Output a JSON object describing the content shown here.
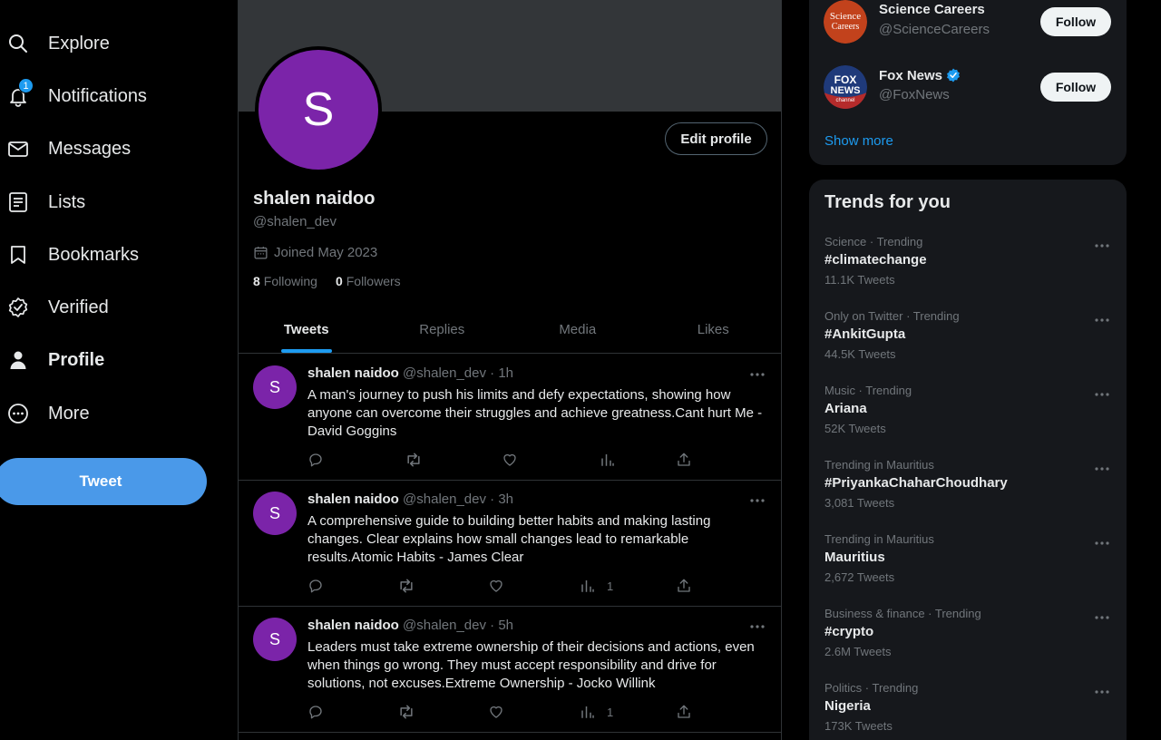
{
  "nav": {
    "items": [
      {
        "label": "Explore",
        "icon": "search-icon"
      },
      {
        "label": "Notifications",
        "icon": "bell-icon",
        "badge": "1"
      },
      {
        "label": "Messages",
        "icon": "envelope-icon"
      },
      {
        "label": "Lists",
        "icon": "list-icon"
      },
      {
        "label": "Bookmarks",
        "icon": "bookmark-icon"
      },
      {
        "label": "Verified",
        "icon": "verified-icon"
      },
      {
        "label": "Profile",
        "icon": "person-icon",
        "active": true
      },
      {
        "label": "More",
        "icon": "more-circle-icon"
      }
    ],
    "tweet_button": "Tweet"
  },
  "profile": {
    "avatar_letter": "S",
    "edit_button": "Edit profile",
    "name": "shalen naidoo",
    "handle": "@shalen_dev",
    "joined": "Joined May 2023",
    "following_count": "8",
    "following_label": "Following",
    "followers_count": "0",
    "followers_label": "Followers"
  },
  "tabs": [
    "Tweets",
    "Replies",
    "Media",
    "Likes"
  ],
  "tweets": [
    {
      "avatar": "S",
      "name": "shalen naidoo",
      "handle": "@shalen_dev",
      "sep": "·",
      "time": "1h",
      "text": "A man's journey to push his limits and defy expectations, showing how anyone can overcome their struggles and achieve greatness.Cant hurt Me - David Goggins",
      "views": ""
    },
    {
      "avatar": "S",
      "name": "shalen naidoo",
      "handle": "@shalen_dev",
      "sep": "·",
      "time": "3h",
      "text": "A comprehensive guide to building better habits and making lasting changes. Clear explains how small changes lead to remarkable results.Atomic Habits - James Clear",
      "views": "1"
    },
    {
      "avatar": "S",
      "name": "shalen naidoo",
      "handle": "@shalen_dev",
      "sep": "·",
      "time": "5h",
      "text": "Leaders must take extreme ownership of their decisions and actions, even when things go wrong. They must accept responsibility and drive for solutions, not excuses.Extreme Ownership - Jocko Willink",
      "views": "1"
    }
  ],
  "who_to_follow": {
    "accounts": [
      {
        "name": "Science Careers",
        "handle": "@ScienceCareers",
        "button": "Follow",
        "logo_text": "Science Careers",
        "verified": false
      },
      {
        "name": "Fox News",
        "handle": "@FoxNews",
        "button": "Follow",
        "logo_text": "FOX NEWS channel",
        "verified": true
      }
    ],
    "show_more": "Show more"
  },
  "trends": {
    "title": "Trends for you",
    "items": [
      {
        "context": "Science · Trending",
        "name": "#climatechange",
        "count": "11.1K Tweets"
      },
      {
        "context": "Only on Twitter · Trending",
        "name": "#AnkitGupta",
        "count": "44.5K Tweets"
      },
      {
        "context": "Music · Trending",
        "name": "Ariana",
        "count": "52K Tweets"
      },
      {
        "context": "Trending in Mauritius",
        "name": "#PriyankaChaharChoudhary",
        "count": "3,081 Tweets"
      },
      {
        "context": "Trending in Mauritius",
        "name": "Mauritius",
        "count": "2,672 Tweets"
      },
      {
        "context": "Business & finance · Trending",
        "name": "#crypto",
        "count": "2.6M Tweets"
      },
      {
        "context": "Politics · Trending",
        "name": "Nigeria",
        "count": "173K Tweets"
      }
    ]
  },
  "colors": {
    "accent": "#1d9bf0",
    "tweet_button": "#4a99e9",
    "avatar": "#7b24a9",
    "banner": "#333639",
    "panel": "#16181c"
  }
}
